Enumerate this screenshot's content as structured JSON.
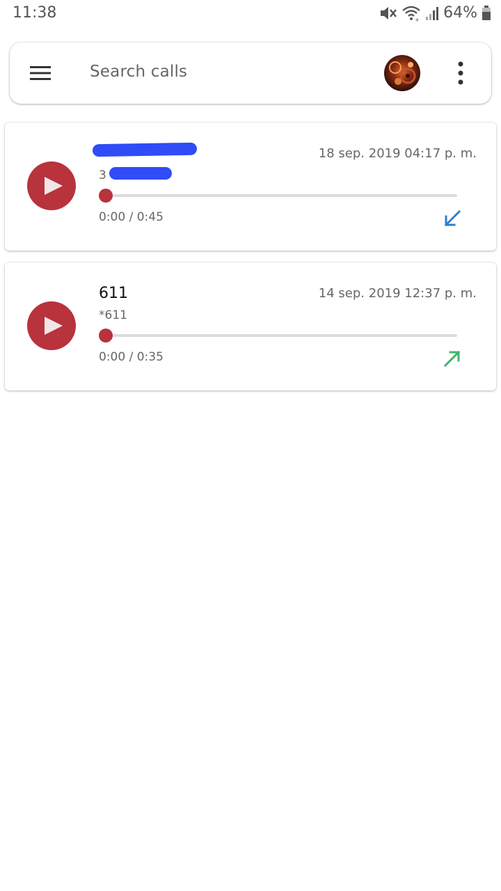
{
  "status_bar": {
    "time": "11:38",
    "battery": "64%"
  },
  "search": {
    "placeholder": "Search calls"
  },
  "calls": [
    {
      "name": "",
      "number": "3",
      "date": "18 sep. 2019 04:17 p. m.",
      "time": "0:00 / 0:45",
      "direction": "incoming",
      "direction_icon": "arrow-down-left-icon",
      "direction_color": "#2e7fd0",
      "progress": 0
    },
    {
      "name": "611",
      "number": "*611",
      "date": "14 sep. 2019 12:37 p. m.",
      "time": "0:00 / 0:35",
      "direction": "outgoing",
      "direction_icon": "arrow-up-right-icon",
      "direction_color": "#3cb86a",
      "progress": 0
    }
  ],
  "colors": {
    "accent": "#b8333c",
    "track": "#dcdcdc"
  }
}
